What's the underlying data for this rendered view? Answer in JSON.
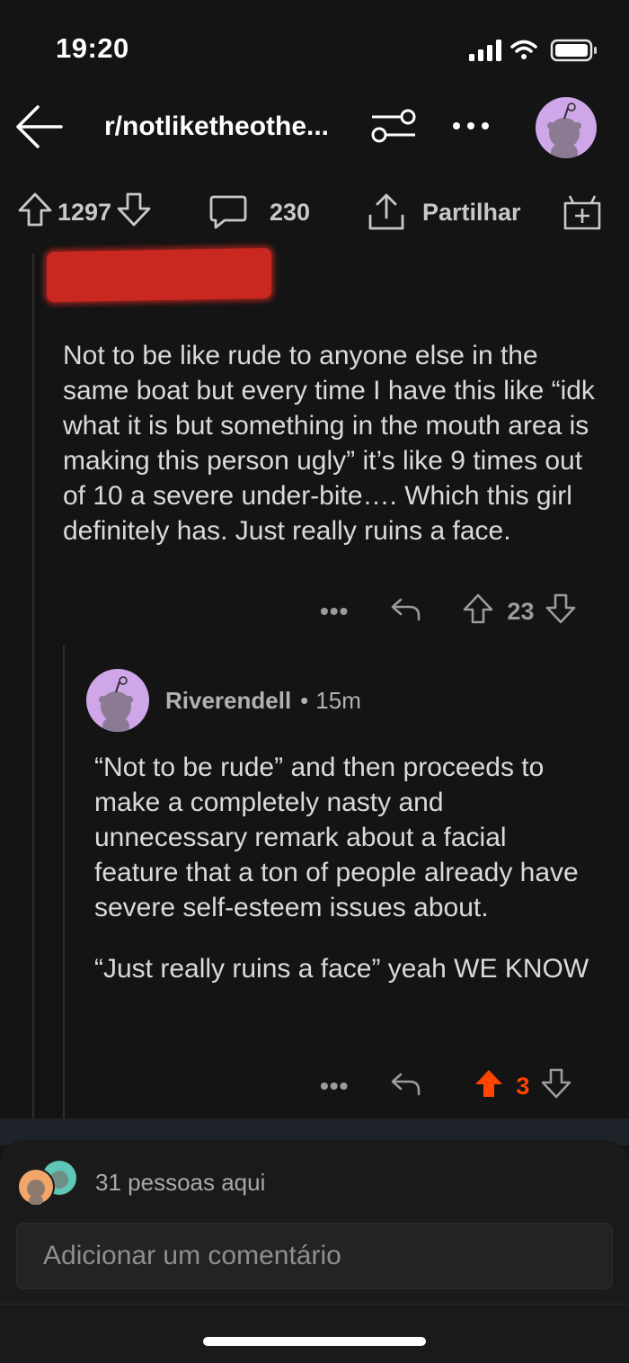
{
  "status_bar": {
    "time": "19:20"
  },
  "header": {
    "subreddit": "r/notliketheothe...",
    "back_icon": "arrow-left-icon",
    "filter_icon": "sliders-icon",
    "more_icon": "ellipsis-icon"
  },
  "post_actions": {
    "upvotes": "1297",
    "comments": "230",
    "share_label": "Partilhar"
  },
  "comment1": {
    "body": "Not to be like rude to anyone else in the same boat but every time I have this like “idk what it is but something in the mouth area is making this person ugly” it’s like 9 times out of 10 a severe under-bite…. Which this girl definitely has. Just really ruins a face.",
    "more": "•••",
    "votes": "23"
  },
  "comment2": {
    "author": "Riverendell",
    "separator": "•",
    "age": "15m",
    "paragraph1": "“Not to be rude” and then proceeds to make a completely nasty and unnecessary remark about a facial feature that a ton of people already have severe self-esteem issues about.",
    "paragraph2": "“Just really ruins a face” yeah WE KNOW",
    "more": "•••",
    "votes": "3",
    "upvoted_color": "#ff4500"
  },
  "bottom": {
    "people_here": "31 pessoas aqui",
    "comment_placeholder": "Adicionar um comentário"
  }
}
